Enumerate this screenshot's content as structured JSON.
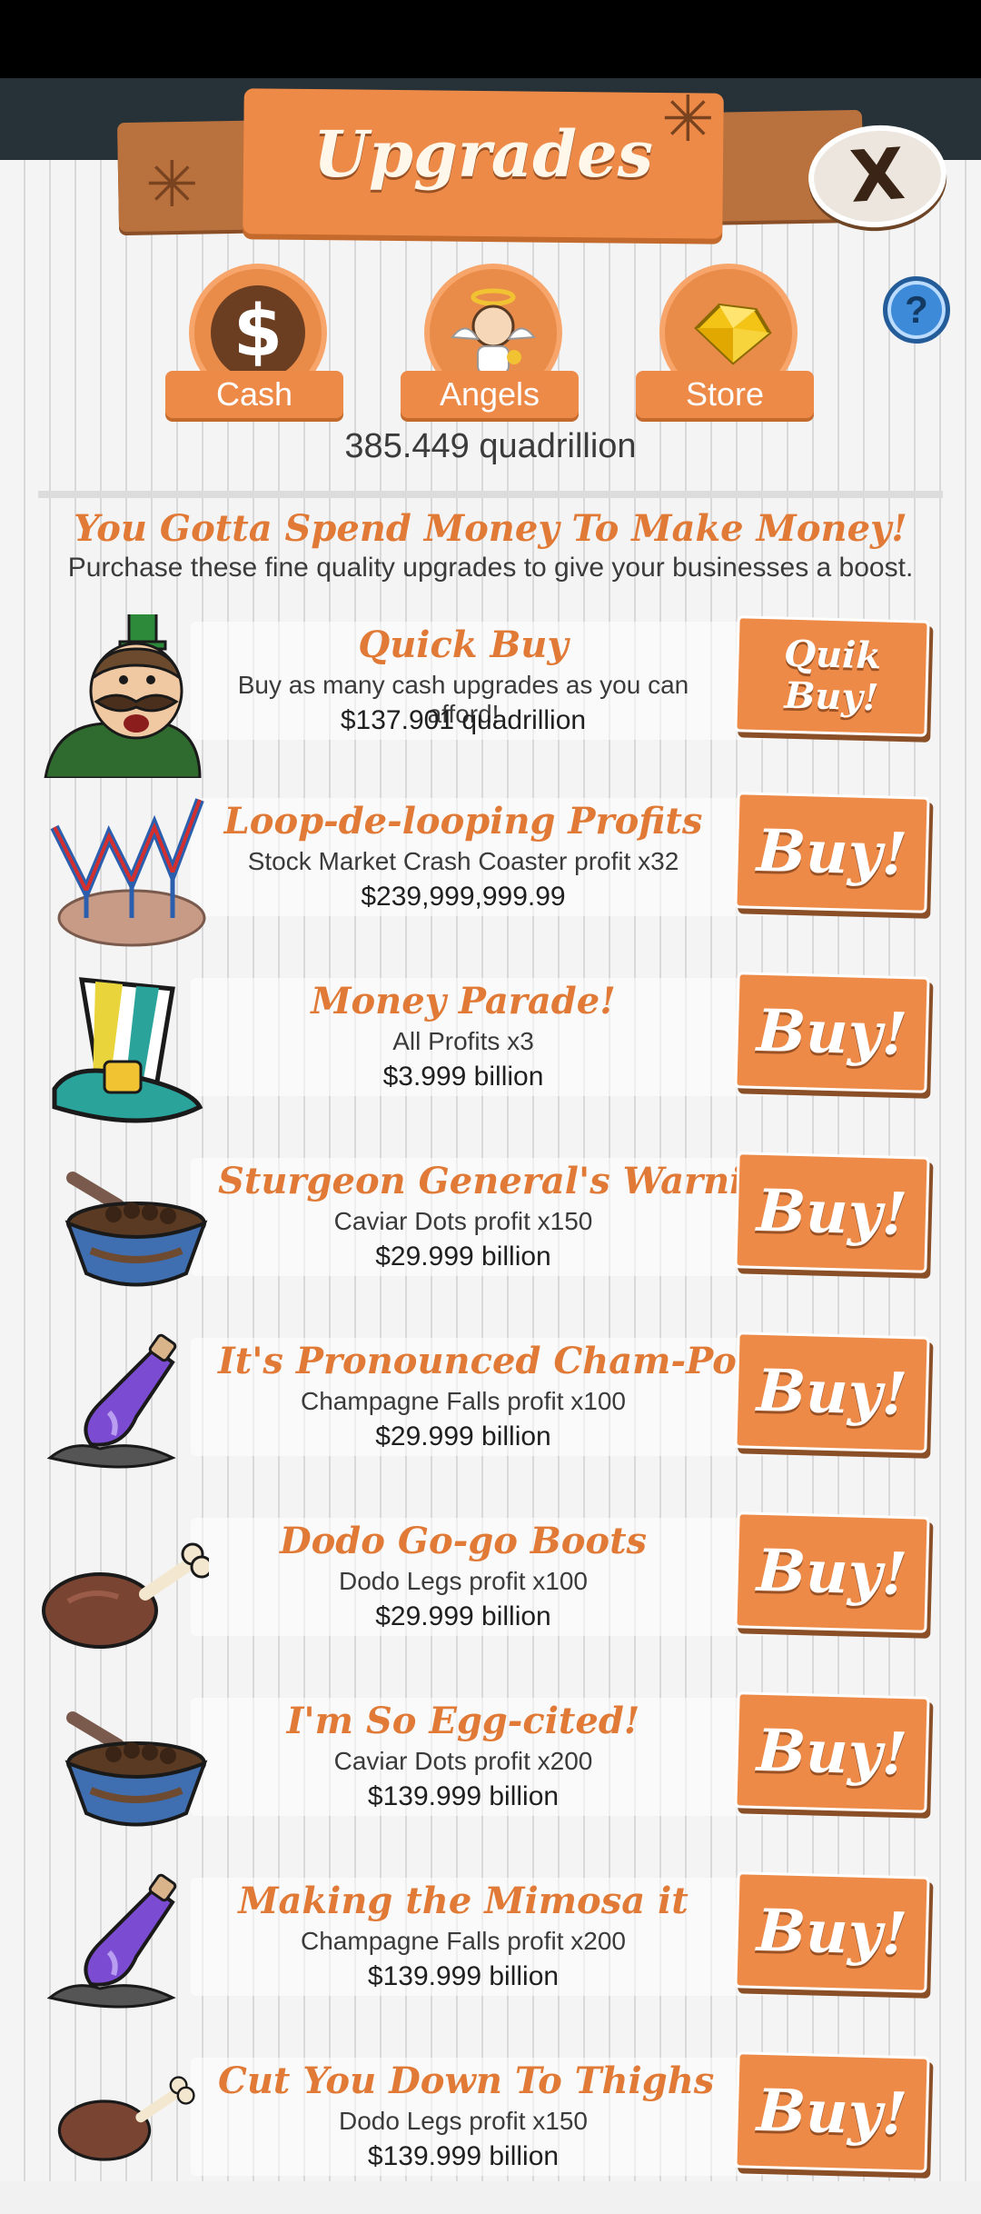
{
  "header": {
    "title": "Upgrades",
    "close_label": "X",
    "help_label": "?"
  },
  "categories": [
    {
      "label": "Cash",
      "icon": "dollar-icon"
    },
    {
      "label": "Angels",
      "icon": "angel-icon"
    },
    {
      "label": "Store",
      "icon": "gold-gem-icon"
    }
  ],
  "currency": "385.449 quadrillion",
  "headline": "You Gotta Spend Money To Make Money!",
  "subheadline": "Purchase these fine quality upgrades to give your businesses a boost.",
  "upgrades": [
    {
      "name": "Quick Buy",
      "desc": "Buy as many cash upgrades as you can afford!",
      "price": "$137.901 quadrillion",
      "button": "Quik\nBuy!",
      "icon": "mustached-tycoon-icon"
    },
    {
      "name": "Loop-de-looping Profits",
      "desc": "Stock Market Crash Coaster profit x32",
      "price": "$239,999,999.99",
      "button": "Buy!",
      "icon": "roller-coaster-icon"
    },
    {
      "name": "Money Parade!",
      "desc": "All Profits x3",
      "price": "$3.999 billion",
      "button": "Buy!",
      "icon": "striped-top-hat-icon"
    },
    {
      "name": "Sturgeon General's Warning",
      "desc": "Caviar Dots profit x150",
      "price": "$29.999 billion",
      "button": "Buy!",
      "icon": "caviar-tin-icon"
    },
    {
      "name": "It's Pronounced Cham-Pog-Na",
      "desc": "Champagne Falls profit x100",
      "price": "$29.999 billion",
      "button": "Buy!",
      "icon": "champagne-bottle-icon"
    },
    {
      "name": "Dodo Go-go Boots",
      "desc": "Dodo Legs profit x100",
      "price": "$29.999 billion",
      "button": "Buy!",
      "icon": "drumstick-icon"
    },
    {
      "name": "I'm So Egg-cited!",
      "desc": "Caviar Dots profit x200",
      "price": "$139.999 billion",
      "button": "Buy!",
      "icon": "caviar-tin-icon"
    },
    {
      "name": "Making the Mimosa it",
      "desc": "Champagne Falls profit x200",
      "price": "$139.999 billion",
      "button": "Buy!",
      "icon": "champagne-bottle-icon"
    },
    {
      "name": "Cut You Down To Thighs",
      "desc": "Dodo Legs profit x150",
      "price": "$139.999 billion",
      "button": "Buy!",
      "icon": "drumstick-icon"
    }
  ]
}
